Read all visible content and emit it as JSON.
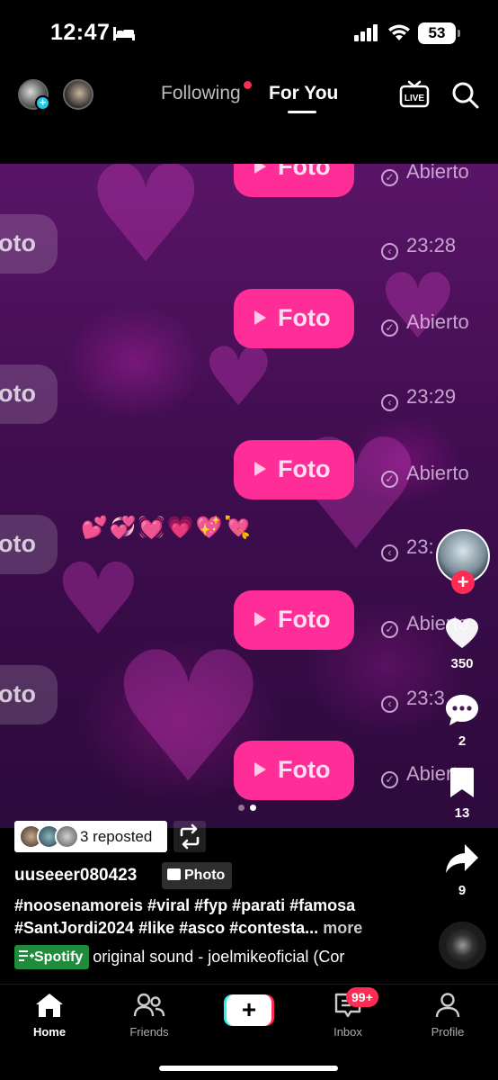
{
  "status_bar": {
    "time": "12:47",
    "battery": "53"
  },
  "top_nav": {
    "tab_following": "Following",
    "tab_for_you": "For You",
    "live_label": "LIVE"
  },
  "chat": {
    "bubble_left_text": "oto",
    "foto_label": "Foto",
    "rows": [
      {
        "type": "right",
        "status": "Abierto"
      },
      {
        "type": "left",
        "status": "23:28"
      },
      {
        "type": "right",
        "status": "Abierto"
      },
      {
        "type": "left",
        "status": "23:29"
      },
      {
        "type": "right",
        "status": "Abierto"
      },
      {
        "type": "left",
        "status": "23:"
      },
      {
        "type": "right",
        "status": "Abierto"
      },
      {
        "type": "left",
        "status": "23:3"
      },
      {
        "type": "right",
        "status": "Abierto"
      }
    ],
    "emoji_row": "💕💞💓💗💖💘"
  },
  "right_rail": {
    "likes": "350",
    "comments": "2",
    "bookmarks": "13",
    "shares": "9"
  },
  "post": {
    "repost_text": "3 reposted",
    "username": "uuseeer080423",
    "photo_tag": "Photo",
    "hashtags_line1": "#noosenamoreis #viral #fyp #parati #famosa",
    "hashtags_line2": "#SantJordi2024 #like #asco #contesta...",
    "more": "more",
    "spotify_label": "Spotify",
    "sound": "original sound - joelmikeoficial (Cor"
  },
  "bottom_nav": {
    "home": "Home",
    "friends": "Friends",
    "inbox": "Inbox",
    "inbox_badge": "99+",
    "profile": "Profile"
  }
}
